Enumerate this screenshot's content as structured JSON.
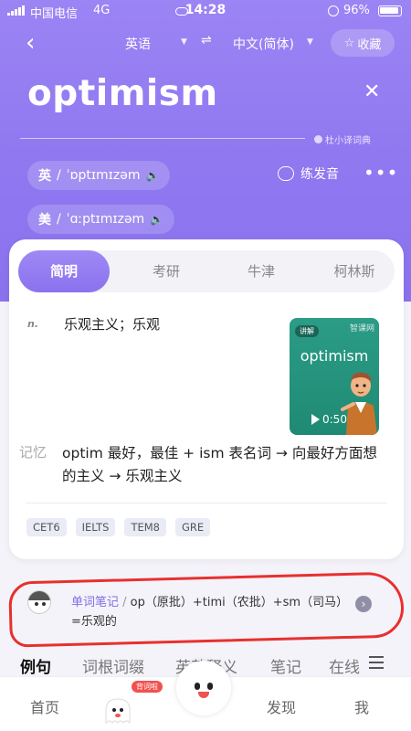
{
  "status_bar": {
    "carrier": "中国电信",
    "network": "4G",
    "time": "14:28",
    "battery": "96%"
  },
  "header": {
    "source_lang": "英语",
    "target_lang": "中文(简体)",
    "favorite_label": "收藏",
    "word": "optimism",
    "dict_brand": "杜小译词典",
    "pron_uk_tag": "英",
    "pron_uk": "ˈɒptɪmɪzəm",
    "pron_us_tag": "美",
    "pron_us": "ˈɑːptɪmɪzəm",
    "practice_label": "练发音"
  },
  "card": {
    "tabs": [
      "简明",
      "考研",
      "牛津",
      "柯林斯"
    ],
    "active_tab": 0,
    "pos": "n.",
    "meaning": "乐观主义；乐观",
    "video": {
      "badge": "讲解",
      "brand": "智课网",
      "word": "optimism",
      "duration": "0:50"
    },
    "memory_label": "记忆",
    "memory_text": "optim 最好，最佳 + ism 表名词 → 向最好方面想的主义 → 乐观主义",
    "chips": [
      "CET6",
      "IELTS",
      "TEM8",
      "GRE"
    ]
  },
  "note": {
    "label": "单词笔记",
    "text": "op（原批）+timi（农批）+sm（司马）=乐观的"
  },
  "section_tabs": [
    "例句",
    "词根词缀",
    "英英释义",
    "笔记",
    "在线"
  ],
  "bottom_nav": {
    "home": "首页",
    "badge": "背词啦",
    "discover": "发现",
    "me": "我"
  },
  "colors": {
    "accent": "#8f78f0",
    "annotation": "#e8302e"
  }
}
